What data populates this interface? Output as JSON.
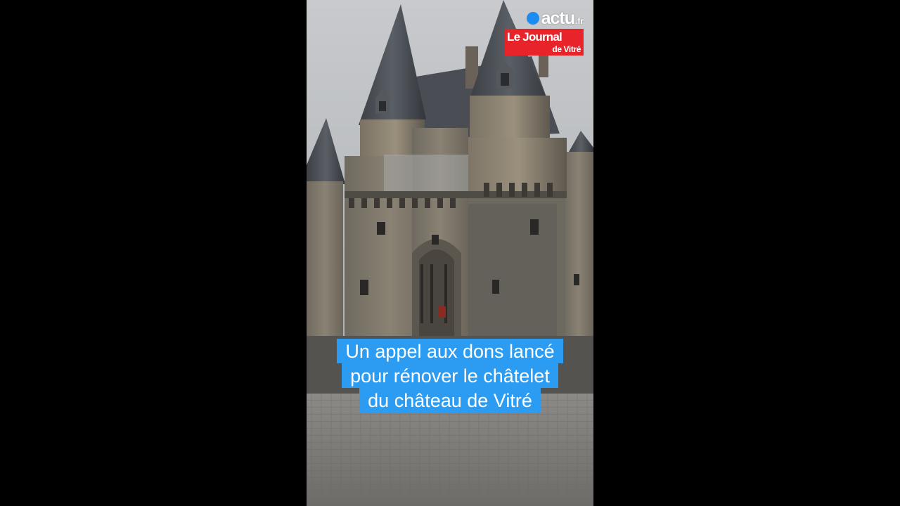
{
  "logo": {
    "brand": "actu",
    "tld": ".fr",
    "journal": "Le Journal",
    "city": "de Vitré",
    "colors": {
      "dot": "#1d8cf0",
      "bar": "#e8242a"
    }
  },
  "caption": {
    "lines": [
      "Un appel aux dons lancé",
      "pour rénover le châtelet",
      "du château de Vitré"
    ],
    "color": "#2c9cf2"
  },
  "scene": {
    "subject": "castle-facade",
    "sky": "overcast"
  }
}
